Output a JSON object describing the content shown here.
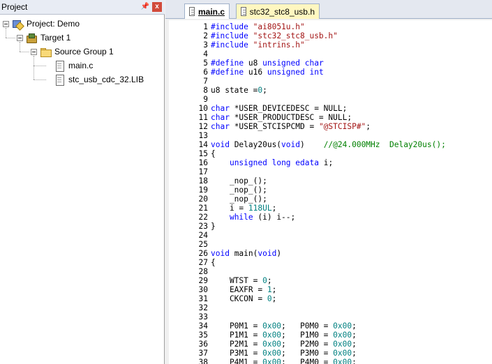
{
  "project_panel": {
    "title": "Project",
    "pin_glyph": "p",
    "close_glyph": "x",
    "tree": [
      {
        "label": "Project: Demo",
        "icon": "project-icon"
      },
      {
        "label": "Target 1",
        "icon": "target-icon"
      },
      {
        "label": "Source Group 1",
        "icon": "folder-icon"
      },
      {
        "label": "main.c",
        "icon": "file-icon"
      },
      {
        "label": "stc_usb_cdc_32.LIB",
        "icon": "file-icon"
      }
    ]
  },
  "editor": {
    "tabs": [
      {
        "label": "main.c",
        "active": true
      },
      {
        "label": "stc32_stc8_usb.h",
        "active": false
      }
    ],
    "lines": [
      {
        "n": "1",
        "t": "#include \"ai8051u.h\""
      },
      {
        "n": "2",
        "t": "#include \"stc32_stc8_usb.h\""
      },
      {
        "n": "3",
        "t": "#include \"intrins.h\""
      },
      {
        "n": "4",
        "t": ""
      },
      {
        "n": "5",
        "t": "#define u8 unsigned char"
      },
      {
        "n": "6",
        "t": "#define u16 unsigned int"
      },
      {
        "n": "7",
        "t": ""
      },
      {
        "n": "8",
        "t": "u8 state =0;"
      },
      {
        "n": "9",
        "t": ""
      },
      {
        "n": "10",
        "t": "char *USER_DEVICEDESC = NULL;"
      },
      {
        "n": "11",
        "t": "char *USER_PRODUCTDESC = NULL;"
      },
      {
        "n": "12",
        "t": "char *USER_STCISPCMD = \"@STCISP#\";"
      },
      {
        "n": "13",
        "t": ""
      },
      {
        "n": "14",
        "t": "void Delay20us(void)    //@24.000MHz  Delay20us();"
      },
      {
        "n": "15",
        "t": "{"
      },
      {
        "n": "16",
        "t": "    unsigned long edata i;"
      },
      {
        "n": "17",
        "t": ""
      },
      {
        "n": "18",
        "t": "    _nop_();"
      },
      {
        "n": "19",
        "t": "    _nop_();"
      },
      {
        "n": "20",
        "t": "    _nop_();"
      },
      {
        "n": "21",
        "t": "    i = 118UL;"
      },
      {
        "n": "22",
        "t": "    while (i) i--;"
      },
      {
        "n": "23",
        "t": "}"
      },
      {
        "n": "24",
        "t": ""
      },
      {
        "n": "25",
        "t": ""
      },
      {
        "n": "26",
        "t": "void main(void)"
      },
      {
        "n": "27",
        "t": "{"
      },
      {
        "n": "28",
        "t": ""
      },
      {
        "n": "29",
        "t": "    WTST = 0;"
      },
      {
        "n": "30",
        "t": "    EAXFR = 1;"
      },
      {
        "n": "31",
        "t": "    CKCON = 0;"
      },
      {
        "n": "32",
        "t": ""
      },
      {
        "n": "33",
        "t": ""
      },
      {
        "n": "34",
        "t": "    P0M1 = 0x00;   P0M0 = 0x00;"
      },
      {
        "n": "35",
        "t": "    P1M1 = 0x00;   P1M0 = 0x00;"
      },
      {
        "n": "36",
        "t": "    P2M1 = 0x00;   P2M0 = 0x00;"
      },
      {
        "n": "37",
        "t": "    P3M1 = 0x00;   P3M0 = 0x00;"
      },
      {
        "n": "38",
        "t": "    P4M1 = 0x00;   P4M0 = 0x00;"
      }
    ]
  },
  "colors": {
    "keyword": "#0000ff",
    "string": "#a31515",
    "number": "#008080",
    "comment": "#008000",
    "header_tab": "#fff7c0"
  }
}
